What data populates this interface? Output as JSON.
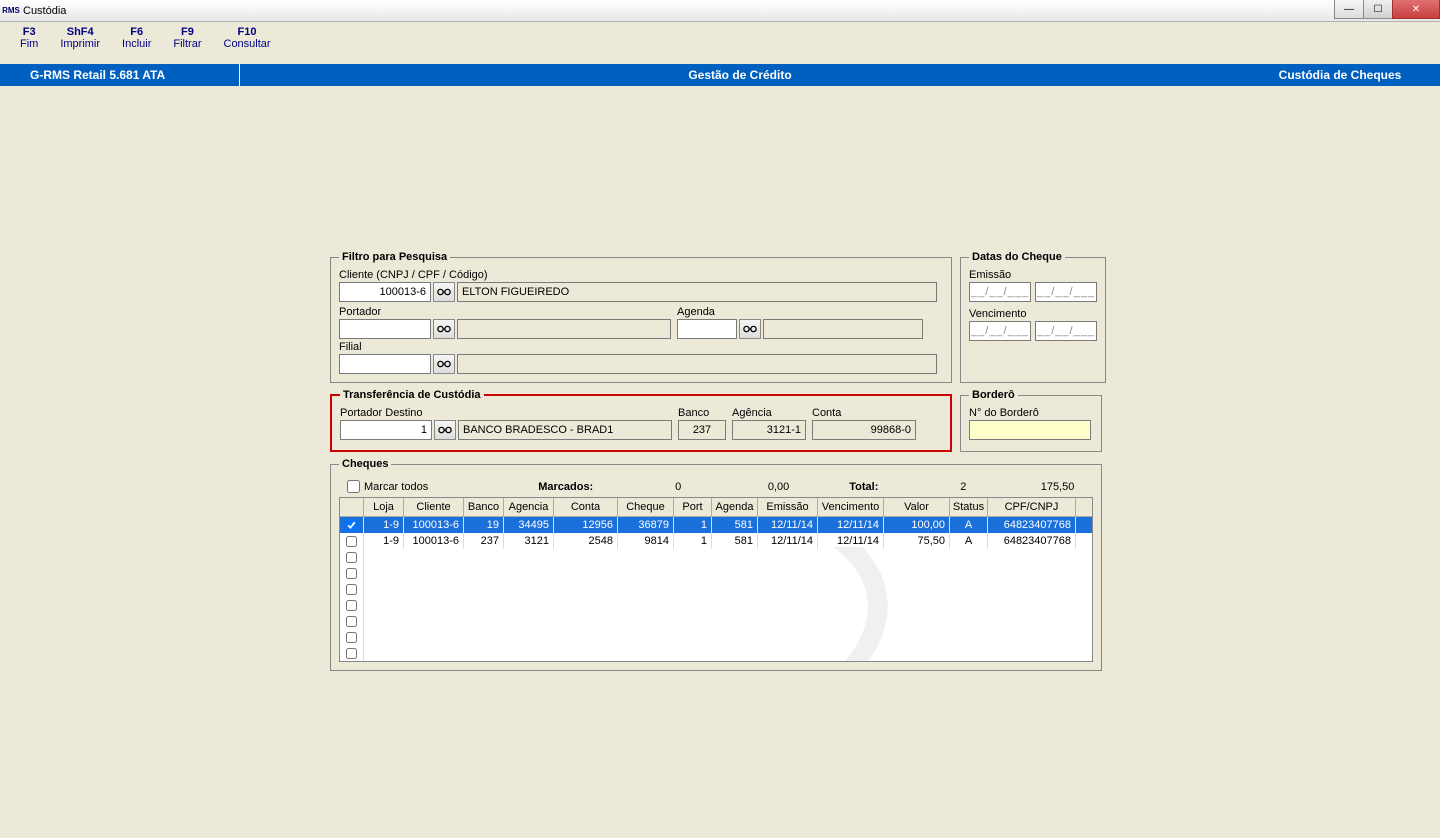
{
  "window": {
    "title": "Custódia"
  },
  "menu": [
    {
      "fk": "F3",
      "label": "Fim"
    },
    {
      "fk": "ShF4",
      "label": "Imprimir"
    },
    {
      "fk": "F6",
      "label": "Incluir"
    },
    {
      "fk": "F9",
      "label": "Filtrar"
    },
    {
      "fk": "F10",
      "label": "Consultar"
    }
  ],
  "bluebar": {
    "left": "G-RMS Retail 5.681 ATA",
    "center": "Gestão de Crédito",
    "right": "Custódia de Cheques"
  },
  "filtro": {
    "legend": "Filtro para Pesquisa",
    "cliente_label": "Cliente (CNPJ / CPF / Código)",
    "cliente_code": "100013-6",
    "cliente_name": "ELTON FIGUEIREDO",
    "portador_label": "Portador",
    "portador_code": "",
    "portador_name": "",
    "agenda_label": "Agenda",
    "agenda_code": "",
    "agenda_name": "",
    "filial_label": "Filial",
    "filial_code": "",
    "filial_name": ""
  },
  "datas": {
    "legend": "Datas do Cheque",
    "emissao_label": "Emissão",
    "vencimento_label": "Vencimento",
    "placeholder": "__/__/___"
  },
  "transferencia": {
    "legend": "Transferência de Custódia",
    "portador_destino_label": "Portador Destino",
    "portador_destino_code": "1",
    "portador_destino_name": "BANCO BRADESCO - BRAD1",
    "banco_label": "Banco",
    "banco": "237",
    "agencia_label": "Agência",
    "agencia": "3121-1",
    "conta_label": "Conta",
    "conta": "99868-0"
  },
  "bordero": {
    "legend": "Borderô",
    "numero_label": "N° do Borderô",
    "numero": ""
  },
  "cheques": {
    "legend": "Cheques",
    "marcar_todos": "Marcar todos",
    "marcados_label": "Marcados:",
    "marcados_count": "0",
    "marcados_sum": "0,00",
    "total_label": "Total:",
    "total_count": "2",
    "total_sum": "175,50",
    "columns": [
      "",
      "Loja",
      "Cliente",
      "Banco",
      "Agencia",
      "Conta",
      "Cheque",
      "Port",
      "Agenda",
      "Emissão",
      "Vencimento",
      "Valor",
      "Status",
      "CPF/CNPJ"
    ],
    "rows": [
      {
        "checked": true,
        "selected": true,
        "loja": "1-9",
        "cliente": "100013-6",
        "banco": "19",
        "agencia": "34495",
        "conta": "12956",
        "cheque": "36879",
        "port": "1",
        "agenda": "581",
        "emissao": "12/11/14",
        "venc": "12/11/14",
        "valor": "100,00",
        "status": "A",
        "cpf": "64823407768"
      },
      {
        "checked": false,
        "selected": false,
        "loja": "1-9",
        "cliente": "100013-6",
        "banco": "237",
        "agencia": "3121",
        "conta": "2548",
        "cheque": "9814",
        "port": "1",
        "agenda": "581",
        "emissao": "12/11/14",
        "venc": "12/11/14",
        "valor": "75,50",
        "status": "A",
        "cpf": "64823407768"
      }
    ]
  }
}
